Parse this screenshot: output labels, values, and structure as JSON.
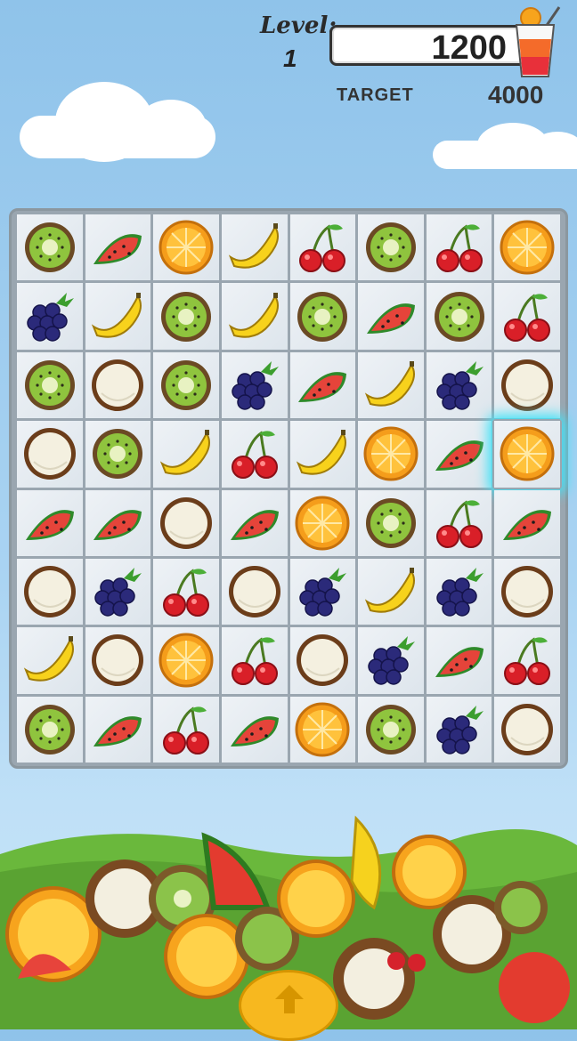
{
  "hud": {
    "level_label": "Level:",
    "level_value": "1",
    "score": "1200",
    "target_label": "TARGET",
    "target_value": "4000"
  },
  "board": {
    "rows": [
      [
        "kiwi",
        "watermelon",
        "orange",
        "banana",
        "cherry",
        "kiwi",
        "cherry",
        "orange"
      ],
      [
        "blackberry",
        "banana",
        "kiwi",
        "banana",
        "kiwi",
        "watermelon",
        "kiwi",
        "cherry"
      ],
      [
        "kiwi",
        "coconut",
        "kiwi",
        "blackberry",
        "watermelon",
        "banana",
        "blackberry",
        "coconut"
      ],
      [
        "coconut",
        "kiwi",
        "banana",
        "cherry",
        "banana",
        "orange",
        "watermelon",
        "orange"
      ],
      [
        "watermelon",
        "watermelon",
        "coconut",
        "watermelon",
        "orange",
        "kiwi",
        "cherry",
        "watermelon"
      ],
      [
        "coconut",
        "blackberry",
        "cherry",
        "coconut",
        "blackberry",
        "banana",
        "blackberry",
        "coconut"
      ],
      [
        "banana",
        "coconut",
        "orange",
        "cherry",
        "coconut",
        "blackberry",
        "watermelon",
        "cherry"
      ],
      [
        "kiwi",
        "watermelon",
        "cherry",
        "watermelon",
        "orange",
        "kiwi",
        "blackberry",
        "coconut"
      ]
    ],
    "selected": {
      "row": 3,
      "col": 7
    }
  },
  "icons": {
    "juice": "juice-glass-icon",
    "up_button": "up-arrow-icon"
  },
  "colors": {
    "sky": "#a9d3f2",
    "board": "#9aa6b0",
    "cell": "#e6ecf1",
    "selection_glow": "#3fe2f7",
    "hill": "#6ab83c",
    "up_button": "#f7b81f"
  }
}
